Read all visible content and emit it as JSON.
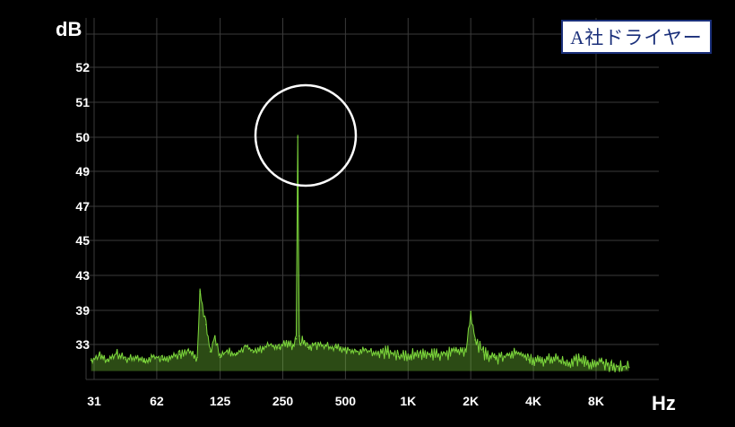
{
  "chart_data": {
    "type": "line",
    "title": "",
    "xlabel": "Hz",
    "ylabel": "dB",
    "x_scale": "log",
    "grid": true,
    "x_ticks": [
      "31",
      "62",
      "125",
      "250",
      "500",
      "1K",
      "2K",
      "4K",
      "8K"
    ],
    "x_tick_values": [
      31,
      62,
      125,
      250,
      500,
      1000,
      2000,
      4000,
      8000
    ],
    "y_ticks": [
      "52",
      "51",
      "50",
      "49",
      "47",
      "45",
      "43",
      "39",
      "33"
    ],
    "legend": {
      "label": "A社ドライヤー",
      "placement": "top-right"
    },
    "series": [
      {
        "name": "A社ドライヤー",
        "color": "#7dd83c",
        "x": [
          30,
          33,
          36,
          40,
          44,
          49,
          54,
          60,
          66,
          73,
          80,
          88,
          97,
          100,
          107,
          112,
          118,
          125,
          135,
          150,
          165,
          180,
          200,
          220,
          240,
          260,
          280,
          290,
          295,
          300,
          305,
          310,
          330,
          360,
          400,
          450,
          500,
          560,
          630,
          700,
          800,
          900,
          1000,
          1150,
          1300,
          1500,
          1700,
          1900,
          2000,
          2100,
          2300,
          2600,
          3000,
          3400,
          3800,
          4300,
          5000,
          5800,
          6600,
          7500,
          8500,
          9500,
          10500,
          11500
        ],
        "y": [
          30.8,
          31.5,
          30.7,
          31.8,
          30.9,
          31.2,
          30.6,
          31.4,
          30.9,
          31.3,
          31.6,
          32.2,
          31.2,
          41.2,
          36.5,
          32.0,
          34.5,
          31.2,
          32.2,
          31.6,
          32.8,
          31.9,
          32.4,
          33.0,
          32.5,
          33.4,
          32.8,
          34.0,
          50.0,
          34.5,
          32.9,
          33.8,
          32.6,
          33.0,
          32.8,
          32.6,
          32.4,
          32.0,
          32.2,
          31.9,
          32.0,
          31.3,
          31.5,
          31.8,
          31.6,
          31.8,
          32.2,
          32.0,
          38.8,
          33.8,
          32.0,
          31.2,
          31.5,
          31.8,
          30.9,
          30.8,
          31.2,
          30.5,
          30.9,
          30.4,
          30.7,
          30.1,
          30.0,
          29.8
        ]
      }
    ]
  }
}
